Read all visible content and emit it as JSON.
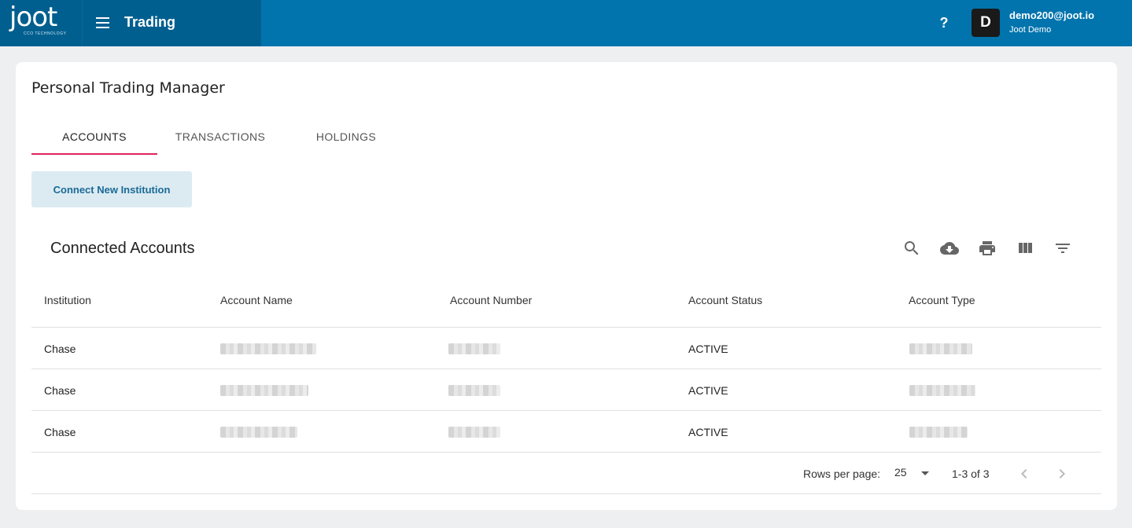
{
  "header": {
    "logo_text": "joot",
    "logo_subtitle": "CCO TECHNOLOGY",
    "app_title": "Trading",
    "help_glyph": "?",
    "avatar_initial": "D",
    "user_email": "demo200@joot.io",
    "user_org": "Joot Demo"
  },
  "page": {
    "title": "Personal Trading Manager"
  },
  "tabs": [
    {
      "label": "ACCOUNTS",
      "active": true
    },
    {
      "label": "TRANSACTIONS",
      "active": false
    },
    {
      "label": "HOLDINGS",
      "active": false
    }
  ],
  "actions": {
    "connect_label": "Connect New Institution"
  },
  "section": {
    "title": "Connected Accounts",
    "tools": [
      "search-icon",
      "cloud-download-icon",
      "print-icon",
      "view-column-icon",
      "filter-list-icon"
    ]
  },
  "table": {
    "columns": [
      "Institution",
      "Account Name",
      "Account Number",
      "Account Status",
      "Account Type"
    ],
    "rows": [
      {
        "institution": "Chase",
        "status": "ACTIVE"
      },
      {
        "institution": "Chase",
        "status": "ACTIVE"
      },
      {
        "institution": "Chase",
        "status": "ACTIVE"
      }
    ]
  },
  "pagination": {
    "rows_per_page_label": "Rows per page:",
    "rows_per_page_value": "25",
    "range_label": "1-3 of 3"
  },
  "colors": {
    "topbar": "#0174ad",
    "brand_panel": "#015f8f",
    "tab_indicator": "#e0245e",
    "button_bg": "#dcebf2",
    "button_text": "#1a6a96"
  }
}
